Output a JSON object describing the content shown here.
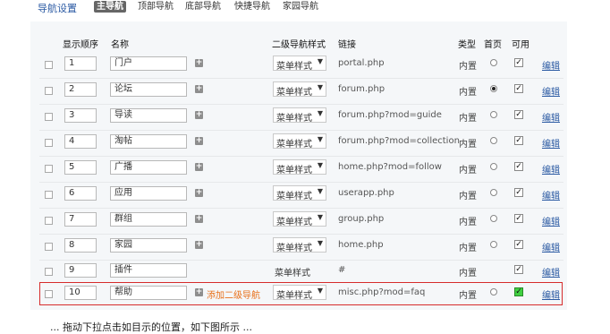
{
  "topbar": {
    "title": "导航设置",
    "tabs": [
      "主导航",
      "顶部导航",
      "底部导航",
      "快捷导航",
      "家园导航"
    ]
  },
  "table": {
    "headers": [
      "显示顺序",
      "名称",
      "二级导航样式",
      "链接",
      "类型",
      "首页",
      "可用"
    ],
    "edit_label": "编辑",
    "rows": [
      {
        "order": "1",
        "name": "门户",
        "style": "菜单样式",
        "link": "portal.php",
        "type": "内置",
        "home": false,
        "enabled": true
      },
      {
        "order": "2",
        "name": "论坛",
        "style": "菜单样式",
        "link": "forum.php",
        "type": "内置",
        "home": true,
        "enabled": true
      },
      {
        "order": "3",
        "name": "导读",
        "style": "菜单样式",
        "link": "forum.php?mod=guide",
        "type": "内置",
        "home": false,
        "enabled": true
      },
      {
        "order": "4",
        "name": "淘帖",
        "style": "菜单样式",
        "link": "forum.php?mod=collection",
        "type": "内置",
        "home": false,
        "enabled": true
      },
      {
        "order": "5",
        "name": "广播",
        "style": "菜单样式",
        "link": "home.php?mod=follow",
        "type": "内置",
        "home": false,
        "enabled": true
      },
      {
        "order": "6",
        "name": "应用",
        "style": "菜单样式",
        "link": "userapp.php",
        "type": "内置",
        "home": false,
        "enabled": true
      },
      {
        "order": "7",
        "name": "群组",
        "style": "菜单样式",
        "link": "group.php",
        "type": "内置",
        "home": false,
        "enabled": true
      },
      {
        "order": "8",
        "name": "家园",
        "style": "菜单样式",
        "link": "home.php",
        "type": "内置",
        "home": false,
        "enabled": true
      },
      {
        "order": "9",
        "name": "插件",
        "style": "菜单样式",
        "link": "#",
        "type": "内置",
        "home": null,
        "enabled": true
      },
      {
        "order": "10",
        "name": "帮助",
        "style": "菜单样式",
        "link": "misc.php?mod=faq",
        "type": "内置",
        "home": false,
        "enabled": true,
        "add_sub": "添加二级导航"
      }
    ]
  },
  "footnote": "... 拖动下拉点击如目示的位置，如下图所示 ..."
}
